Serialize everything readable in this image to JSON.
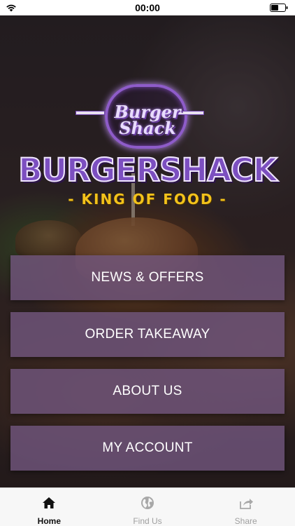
{
  "status_bar": {
    "time": "00:00"
  },
  "logo": {
    "script_line1": "Burger",
    "script_line2": "Shack",
    "wordmark": "BURGERSHACK",
    "tagline": "- KING OF FOOD -"
  },
  "menu": [
    {
      "label": "NEWS & OFFERS"
    },
    {
      "label": "ORDER TAKEAWAY"
    },
    {
      "label": "ABOUT US"
    },
    {
      "label": "MY ACCOUNT"
    }
  ],
  "tabs": [
    {
      "label": "Home",
      "icon": "home-icon",
      "active": true
    },
    {
      "label": "Find Us",
      "icon": "globe-icon",
      "active": false
    },
    {
      "label": "Share",
      "icon": "share-icon",
      "active": false
    }
  ],
  "colors": {
    "brand_purple": "#7c4fc0",
    "brand_yellow": "#f2c21b",
    "button_bg": "#70567d"
  }
}
